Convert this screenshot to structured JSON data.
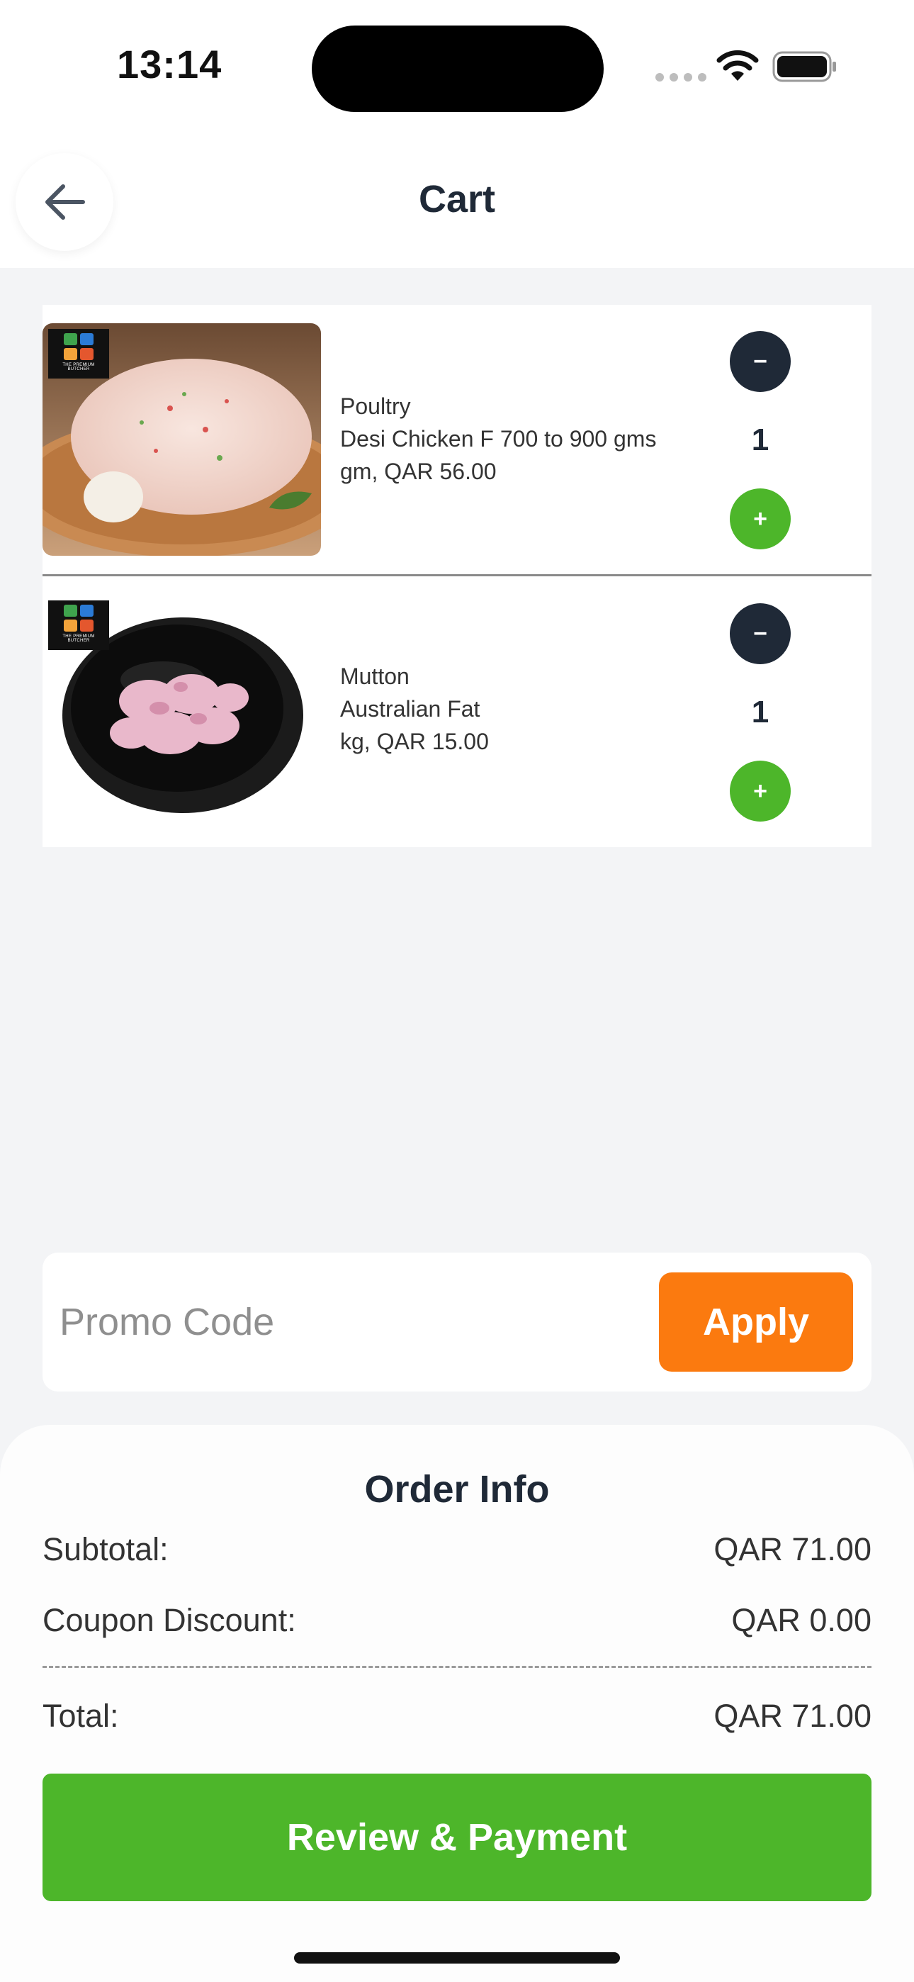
{
  "status_bar": {
    "time": "13:14"
  },
  "header": {
    "title": "Cart"
  },
  "cart": {
    "items": [
      {
        "category": "Poultry",
        "name": "Desi Chicken F 700 to 900 gms",
        "unit_price": "gm, QAR 56.00",
        "quantity": "1",
        "brand": "THE PREMIUM BUTCHER"
      },
      {
        "category": "Mutton",
        "name": "Australian Fat",
        "unit_price": "kg, QAR 15.00",
        "quantity": "1",
        "brand": "THE PREMIUM BUTCHER"
      }
    ],
    "minus_symbol": "−",
    "plus_symbol": "+"
  },
  "promo": {
    "placeholder": "Promo Code",
    "apply_label": "Apply"
  },
  "order_info": {
    "title": "Order Info",
    "subtotal_label": "Subtotal:",
    "subtotal_value": "QAR 71.00",
    "coupon_label": "Coupon Discount:",
    "coupon_value": "QAR 0.00",
    "total_label": "Total:",
    "total_value": "QAR 71.00",
    "pay_label": "Review & Payment"
  },
  "colors": {
    "accent_green": "#4db62a",
    "accent_orange": "#fb7a0f",
    "dark": "#1f2937"
  }
}
